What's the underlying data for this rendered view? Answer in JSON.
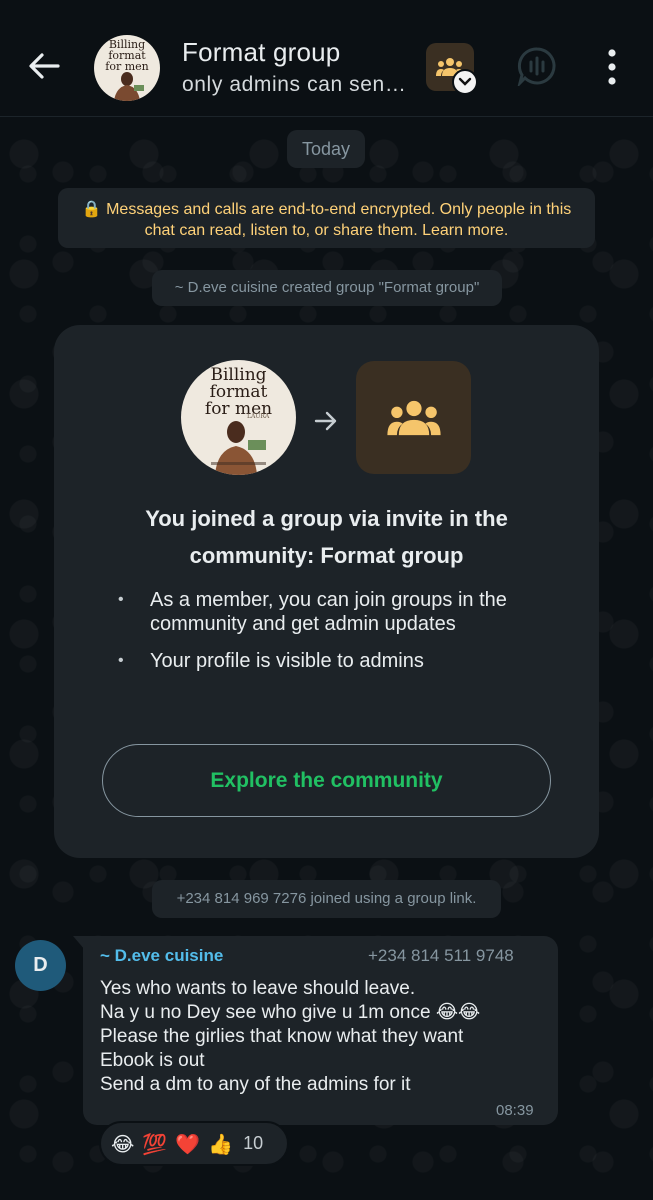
{
  "header": {
    "title": "Format group",
    "subtitle": "only admins can sen…",
    "avatar_cover": [
      "Billing",
      "format",
      "for men"
    ],
    "icons": {
      "back": "arrow-left-icon",
      "community": "community-people-icon",
      "voice": "voice-chat-icon",
      "menu": "more-vertical-icon"
    }
  },
  "chat": {
    "date_label": "Today",
    "encryption_notice": "🔒 Messages and calls are end-to-end encrypted. Only people in this chat can read, listen to, or share them. Learn more.",
    "system_created": "~ D.eve cuisine created group \"Format group\"",
    "community_card": {
      "avatar_cover": [
        "Billing",
        "format",
        "for men"
      ],
      "avatar_author": "LAURA",
      "title_line1": "You joined a group via invite in the",
      "title_line2": "community: Format group",
      "bullets": [
        "As a member, you can join groups in the community and get admin updates",
        "Your profile is visible to admins"
      ],
      "button_label": "Explore the community"
    },
    "system_joined": "+234 814 969 7276 joined using a group link.",
    "message": {
      "avatar_letter": "D",
      "sender_name": "~ D.eve cuisine",
      "sender_phone": "+234 814 511 9748",
      "lines": [
        "Yes who wants to leave should leave.",
        "Na y u no Dey see who give u 1m once 😂😂",
        "Please the girlies that know what they want",
        "Ebook is out",
        "Send a dm to any of the admins for it"
      ],
      "time": "08:39",
      "reactions": [
        "😂",
        "💯",
        "❤️",
        "👍"
      ],
      "reaction_count": "10"
    }
  },
  "colors": {
    "background": "#0b1014",
    "bubble": "#1d2328",
    "accent_green": "#21c063",
    "notice_yellow": "#ffd279",
    "sender_blue": "#53bdeb",
    "community_tile": "#3a2f22",
    "community_icon": "#f5c56b"
  }
}
